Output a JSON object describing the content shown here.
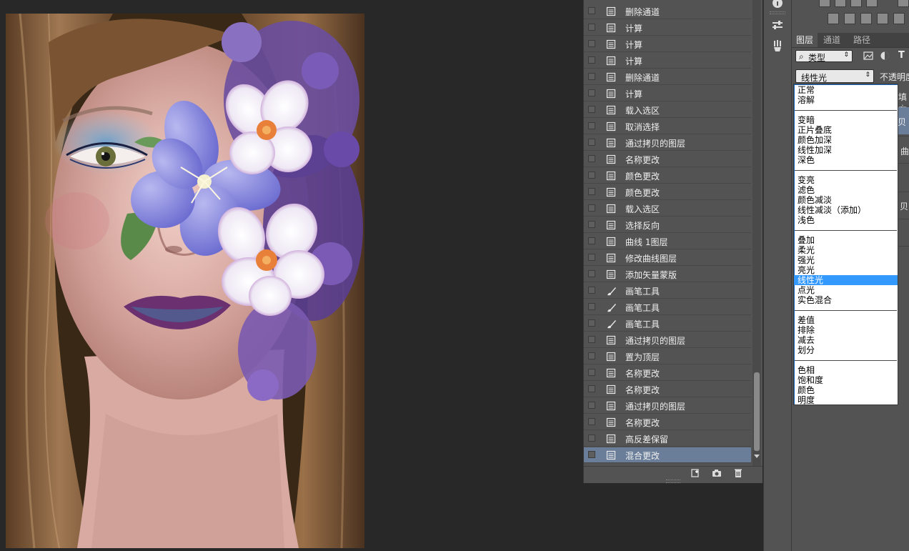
{
  "history": {
    "items": [
      {
        "label": "删除通道",
        "icon": "document-icon"
      },
      {
        "label": "计算",
        "icon": "document-icon"
      },
      {
        "label": "计算",
        "icon": "document-icon"
      },
      {
        "label": "计算",
        "icon": "document-icon"
      },
      {
        "label": "删除通道",
        "icon": "document-icon"
      },
      {
        "label": "计算",
        "icon": "document-icon"
      },
      {
        "label": "载入选区",
        "icon": "document-icon"
      },
      {
        "label": "取消选择",
        "icon": "document-icon"
      },
      {
        "label": "通过拷贝的图层",
        "icon": "document-icon"
      },
      {
        "label": "名称更改",
        "icon": "document-icon"
      },
      {
        "label": "颜色更改",
        "icon": "document-icon"
      },
      {
        "label": "颜色更改",
        "icon": "document-icon"
      },
      {
        "label": "载入选区",
        "icon": "document-icon"
      },
      {
        "label": "选择反向",
        "icon": "document-icon"
      },
      {
        "label": "曲线 1图层",
        "icon": "document-icon"
      },
      {
        "label": "修改曲线图层",
        "icon": "document-icon"
      },
      {
        "label": "添加矢量蒙版",
        "icon": "document-icon"
      },
      {
        "label": "画笔工具",
        "icon": "brush-icon"
      },
      {
        "label": "画笔工具",
        "icon": "brush-icon"
      },
      {
        "label": "画笔工具",
        "icon": "brush-icon"
      },
      {
        "label": "通过拷贝的图层",
        "icon": "document-icon"
      },
      {
        "label": "置为顶层",
        "icon": "document-icon"
      },
      {
        "label": "名称更改",
        "icon": "document-icon"
      },
      {
        "label": "名称更改",
        "icon": "document-icon"
      },
      {
        "label": "通过拷贝的图层",
        "icon": "document-icon"
      },
      {
        "label": "名称更改",
        "icon": "document-icon"
      },
      {
        "label": "高反差保留",
        "icon": "document-icon"
      },
      {
        "label": "混合更改",
        "icon": "document-icon",
        "selected": true
      }
    ]
  },
  "layers": {
    "tabs": [
      "图层",
      "通道",
      "路径"
    ],
    "active_tab": "图层",
    "filter_label": "类型",
    "blend_mode": "线性光",
    "opacity_label": "不透明度",
    "fill_label": "填充",
    "visible_layer_fragments": [
      "贝",
      "曲",
      "贝"
    ]
  },
  "blend_menu": {
    "groups": [
      [
        "正常",
        "溶解"
      ],
      [
        "变暗",
        "正片叠底",
        "颜色加深",
        "线性加深",
        "深色"
      ],
      [
        "变亮",
        "滤色",
        "颜色减淡",
        "线性减淡（添加）",
        "浅色"
      ],
      [
        "叠加",
        "柔光",
        "强光",
        "亮光",
        "线性光",
        "点光",
        "实色混合"
      ],
      [
        "差值",
        "排除",
        "减去",
        "划分"
      ],
      [
        "色相",
        "饱和度",
        "颜色",
        "明度"
      ]
    ],
    "selected": "线性光"
  },
  "colors": {
    "accent_selection": "#3399ff",
    "history_selected_row": "#6a7e9a",
    "panel_bg": "#535353"
  }
}
